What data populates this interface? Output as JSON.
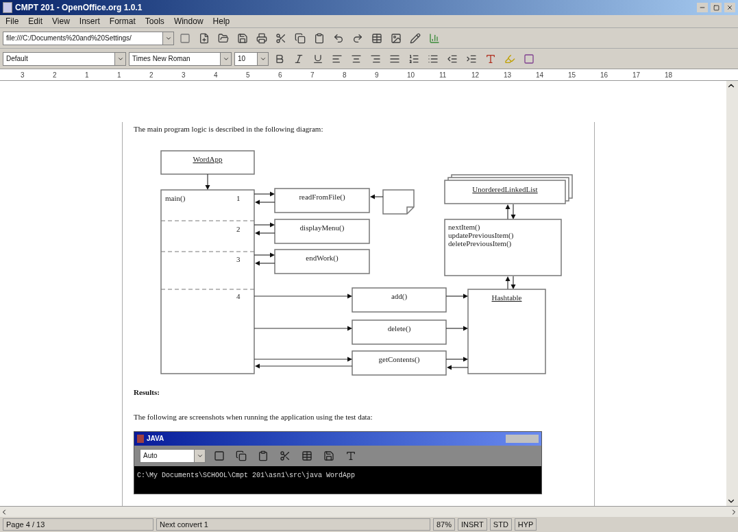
{
  "window": {
    "title": "CMPT 201 - OpenOffice.org 1.0.1"
  },
  "menu": [
    "File",
    "Edit",
    "View",
    "Insert",
    "Format",
    "Tools",
    "Window",
    "Help"
  ],
  "url_field": {
    "value": "file:///C:/Documents%20and%20Settings/"
  },
  "format_bar": {
    "style": "Default",
    "font": "Times New Roman",
    "size": "10"
  },
  "ruler": [
    "3",
    "2",
    "1",
    "1",
    "2",
    "3",
    "4",
    "5",
    "6",
    "7",
    "8",
    "9",
    "10",
    "11",
    "12",
    "13",
    "14",
    "15",
    "16",
    "17",
    "18"
  ],
  "document": {
    "intro": "The main program logic is described in the following diagram:",
    "diagram": {
      "main_class": "WordApp",
      "main_method": "main()",
      "steps": [
        "1",
        "2",
        "3",
        "4"
      ],
      "calls": [
        "readFromFile()",
        "displayMenu()",
        "endWork()"
      ],
      "list_class": "UnorderedLinkedList",
      "list_methods": [
        "nextItem()",
        "updatePreviousItem()",
        "deletePreviousItem()"
      ],
      "table_ops": [
        "add()",
        "delete()",
        "getContents()"
      ],
      "table_class": "Hashtable"
    },
    "heading": "Results:",
    "paragraph": "The following are screenshots when running the application using the test data:",
    "console_window": {
      "title": "JAVA",
      "font_size": "Auto",
      "prompt": "C:\\My Documents\\SCHOOL\\Cmpt 201\\asn1\\src\\java WordApp"
    }
  },
  "status_bar": [
    "Page 4 / 13",
    "Next convert 1",
    "87%",
    "INSRT",
    "STD",
    "HYP"
  ]
}
